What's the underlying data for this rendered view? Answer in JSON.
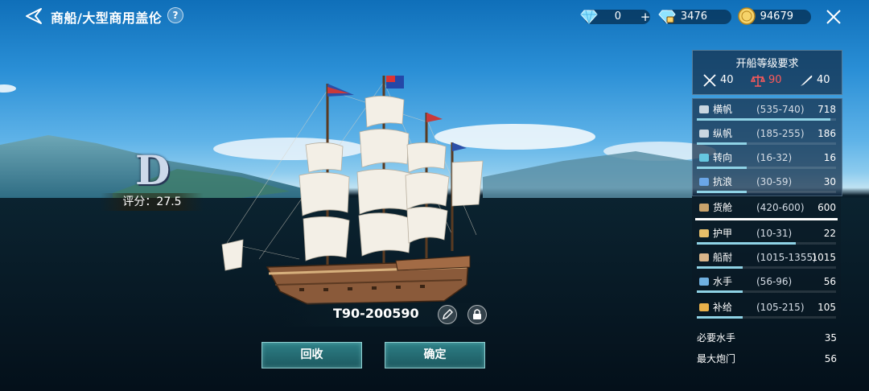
{
  "header": {
    "title": "商船/大型商用盖伦",
    "help": "?"
  },
  "resources": [
    {
      "name": "diamond-icon",
      "value": "0",
      "plus": "+"
    },
    {
      "name": "bound-diamond-icon",
      "value": "3476"
    },
    {
      "name": "gold-coin-icon",
      "value": "94679"
    }
  ],
  "ship": {
    "grade": "D",
    "score_label": "评分：27.5",
    "name": "T90-200590"
  },
  "buttons": {
    "recycle": "回收",
    "confirm": "确定"
  },
  "requirements": {
    "title": "开船等级要求",
    "items": [
      {
        "icon": "crossed-swords-icon",
        "value": "40",
        "color": "#ffffff"
      },
      {
        "icon": "scales-icon",
        "value": "90",
        "color": "#ff5a5a"
      },
      {
        "icon": "quill-icon",
        "value": "40",
        "color": "#ffffff"
      }
    ]
  },
  "stats": [
    {
      "icon": "square-sail-icon",
      "name": "横帆",
      "range": "(535-740)",
      "value": "718",
      "fill": 0.96
    },
    {
      "icon": "lateen-sail-icon",
      "name": "纵帆",
      "range": "(185-255)",
      "value": "186",
      "fill": 0.36
    },
    {
      "icon": "rudder-icon",
      "name": "转向",
      "range": "(16-32)",
      "value": "16",
      "fill": 0.36
    },
    {
      "icon": "wave-icon",
      "name": "抗浪",
      "range": "(30-59)",
      "value": "30",
      "fill": 0.36
    },
    {
      "icon": "cargo-barrel-icon",
      "name": "货舱",
      "range": "(420-600)",
      "value": "600",
      "fill": 1.0,
      "highlight": true
    },
    {
      "icon": "armor-icon",
      "name": "护甲",
      "range": "(10-31)",
      "value": "22",
      "fill": 0.71
    },
    {
      "icon": "hull-icon",
      "name": "船耐",
      "range": "(1015-1355)",
      "value": "1015",
      "fill": 0.33
    },
    {
      "icon": "sailor-icon",
      "name": "水手",
      "range": "(56-96)",
      "value": "56",
      "fill": 0.33
    },
    {
      "icon": "supply-icon",
      "name": "补给",
      "range": "(105-215)",
      "value": "105",
      "fill": 0.33
    }
  ],
  "extras": [
    {
      "name": "必要水手",
      "value": "35"
    },
    {
      "name": "最大炮门",
      "value": "56"
    }
  ]
}
